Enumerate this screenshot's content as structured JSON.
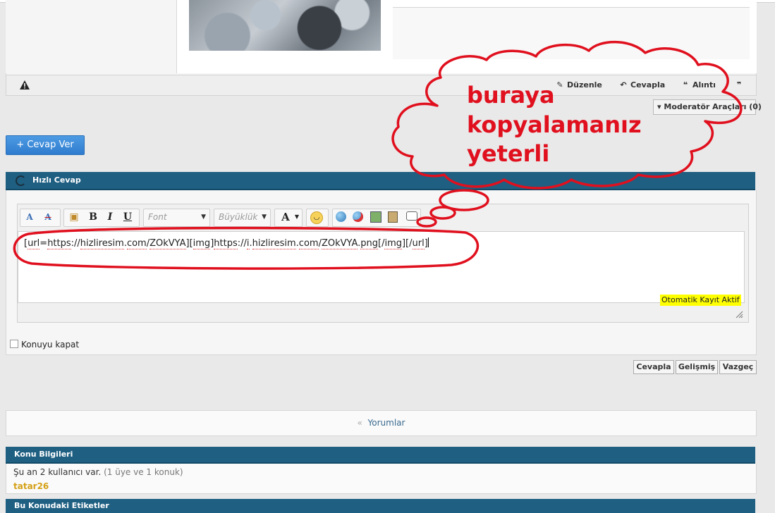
{
  "post": {
    "actions": {
      "edit": "Düzenle",
      "reply": "Cevapla",
      "quote": "Alıntı"
    },
    "moderator_tools": "Moderatör Araçları (0)"
  },
  "reply_button": "+ Cevap Ver",
  "quick_reply": {
    "title": "Hızlı Cevap",
    "toolbar": {
      "font_placeholder": "Font",
      "size_placeholder": "Büyüklük"
    },
    "text_value": {
      "p1": "[",
      "p2": "url",
      "p3": "=",
      "p4": "https",
      "p5": "://",
      "p6": "hizliresim",
      "p7": ".",
      "p8": "com",
      "p9": "/",
      "p10": "ZOkVYA",
      "p11": "][",
      "p12": "img",
      "p13": "]",
      "p14": "https",
      "p15": "://",
      "p16": "i",
      "p17": ".",
      "p18": "hizliresim",
      "p19": ".",
      "p20": "com",
      "p21": "/",
      "p22": "ZOkVYA",
      "p23": ".",
      "p24": "png",
      "p25": "[/",
      "p26": "img",
      "p27": "][/",
      "p28": "url",
      "p29": "]"
    },
    "autosave_badge": "Otomatik Kayıt Aktif",
    "close_topic_label": "Konuyu kapat",
    "buttons": {
      "submit": "Cevapla",
      "advanced": "Gelişmiş",
      "cancel": "Vazgeç"
    }
  },
  "comments_link": "Yorumlar",
  "comments_arrow": "«",
  "topic_info": {
    "title": "Konu Bilgileri",
    "users_line": "Şu an 2 kullanıcı var.",
    "users_detail": "(1 üye ve 1 konuk)",
    "member": "tatar26"
  },
  "tags_title": "Bu Konudaki Etiketler",
  "annotation": {
    "line1": "buraya",
    "line2": "kopyalamanız",
    "line3": "yeterli",
    "color": "#e0101e"
  }
}
